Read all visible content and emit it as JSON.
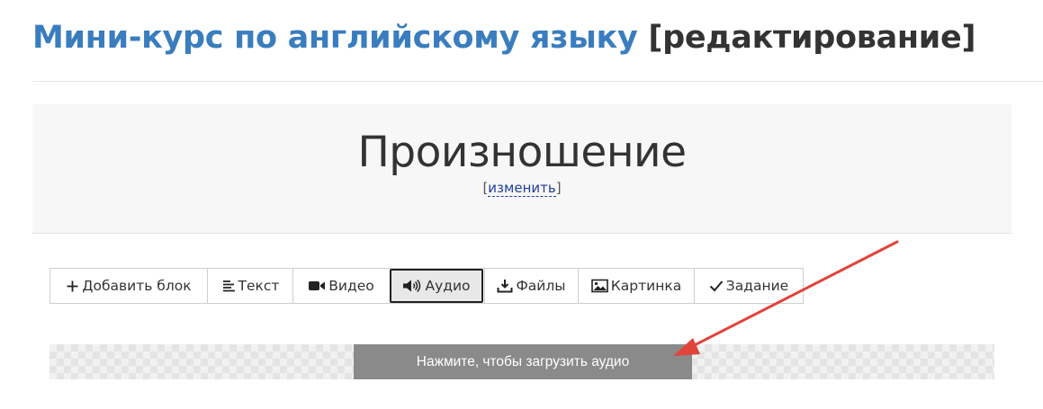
{
  "header": {
    "course_title": "Мини-курс по английскому языку",
    "mode_label": "[редактирование]"
  },
  "lesson": {
    "title": "Произношение",
    "edit_open": "[",
    "edit_label": "изменить",
    "edit_close": "]"
  },
  "toolbar": {
    "buttons": [
      {
        "label": "Добавить блок",
        "icon": "plus-icon"
      },
      {
        "label": "Текст",
        "icon": "text-lines-icon"
      },
      {
        "label": "Видео",
        "icon": "video-camera-icon"
      },
      {
        "label": "Аудио",
        "icon": "speaker-icon",
        "active": true
      },
      {
        "label": "Файлы",
        "icon": "download-icon"
      },
      {
        "label": "Картинка",
        "icon": "image-icon"
      },
      {
        "label": "Задание",
        "icon": "checkmark-icon"
      }
    ]
  },
  "upload": {
    "label": "Нажмите, чтобы загрузить аудио"
  },
  "colors": {
    "link_blue": "#3a7dbf",
    "annotation_arrow": "#e0443a",
    "upload_button": "#8a8a8a"
  }
}
